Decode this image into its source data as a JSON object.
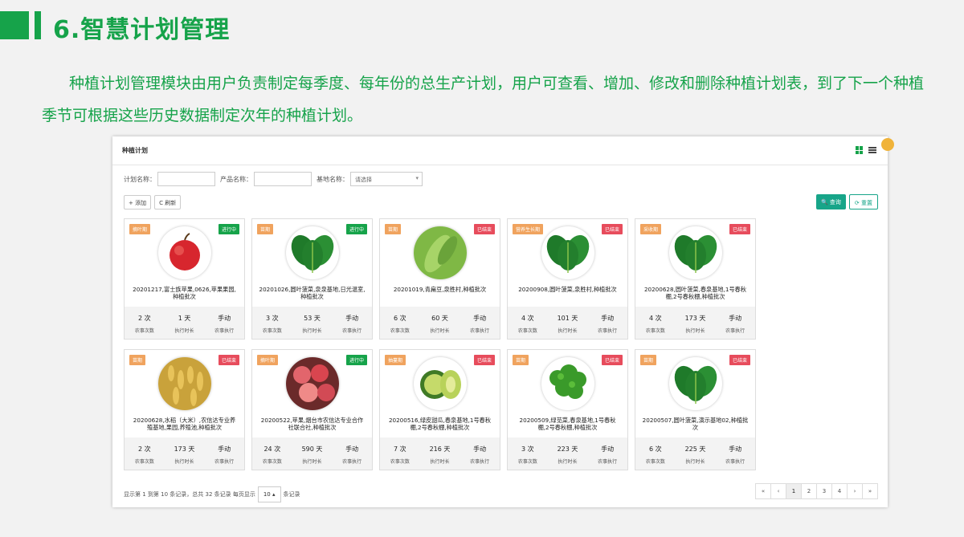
{
  "slide": {
    "title": "6.智慧计划管理",
    "description": "种植计划管理模块由用户负责制定每季度、每年份的总生产计划，用户可查看、增加、修改和删除种植计划表，到了下一个种植季节可根据这些历史数据制定次年的种植计划。"
  },
  "panel": {
    "title": "种植计划",
    "filters": {
      "plan_name_label": "计划名称：",
      "product_name_label": "产品名称：",
      "base_name_label": "基地名称：",
      "base_select_value": "请选择"
    },
    "toolbar": {
      "add": "+ 添加",
      "refresh": "C 刷新"
    },
    "buttons": {
      "search": "查询",
      "reset": "重置"
    },
    "stat_labels": {
      "farm": "农事次数",
      "duration": "执行时长",
      "exec": "农事执行"
    },
    "cards": [
      {
        "stage": "摘叶期",
        "status": "进行中",
        "status_type": "running",
        "photo": "apple",
        "title": "20201217,富士族苹果,0626,苹果果园,种植批次",
        "farm_count": "2 次",
        "duration": "1 天",
        "exec": "手动"
      },
      {
        "stage": "苗期",
        "status": "进行中",
        "status_type": "running",
        "photo": "spinach",
        "title": "20201026,圆叶菠菜,泉泉基地,日光温室,种植批次",
        "farm_count": "3 次",
        "duration": "53 天",
        "exec": "手动"
      },
      {
        "stage": "苗期",
        "status": "已结束",
        "status_type": "ended",
        "photo": "beans",
        "title": "20201019,青扁豆,泉胜村,种植批次",
        "farm_count": "6 次",
        "duration": "60 天",
        "exec": "手动"
      },
      {
        "stage": "营养生长期",
        "status": "已结束",
        "status_type": "ended",
        "photo": "spinach",
        "title": "20200908,圆叶菠菜,泉胜村,种植批次",
        "farm_count": "4 次",
        "duration": "101 天",
        "exec": "手动"
      },
      {
        "stage": "采收期",
        "status": "已结束",
        "status_type": "ended",
        "photo": "spinach",
        "title": "20200628,圆叶菠菜,春泉基地,1号春秋棚,2号春秋棚,种植批次",
        "farm_count": "4 次",
        "duration": "173 天",
        "exec": "手动"
      },
      {
        "stage": "苗期",
        "status": "已结束",
        "status_type": "ended",
        "photo": "rice",
        "title": "20200628,水稻（大米）,农信达专业养殖基地,果园,养殖池,种植批次",
        "farm_count": "2 次",
        "duration": "173 天",
        "exec": "手动"
      },
      {
        "stage": "摘叶期",
        "status": "进行中",
        "status_type": "running",
        "photo": "apples",
        "title": "20200522,苹果,烟台市农信达专业合作社联合社,种植批次",
        "farm_count": "24 次",
        "duration": "590 天",
        "exec": "手动"
      },
      {
        "stage": "抽蔓期",
        "status": "已结束",
        "status_type": "ended",
        "photo": "melon",
        "title": "20200516,绿皮甜瓜,春泉基地,1号春秋棚,2号春秋棚,种植批次",
        "farm_count": "7 次",
        "duration": "216 天",
        "exec": "手动"
      },
      {
        "stage": "苗期",
        "status": "已结束",
        "status_type": "ended",
        "photo": "greens",
        "title": "20200509,绿苋菜,春泉基地,1号春秋棚,2号春秋棚,种植批次",
        "farm_count": "3 次",
        "duration": "223 天",
        "exec": "手动"
      },
      {
        "stage": "苗期",
        "status": "已结束",
        "status_type": "ended",
        "photo": "spinach",
        "title": "20200507,圆叶菠菜,演示基地02,种植批次",
        "farm_count": "6 次",
        "duration": "225 天",
        "exec": "手动"
      }
    ],
    "pagination": {
      "info_prefix": "显示第 1 到第 10 条记录，总共 32 条记录 每页显示",
      "page_size": "10 ▴",
      "info_suffix": "条记录",
      "buttons": [
        "«",
        "‹",
        "1",
        "2",
        "3",
        "4",
        "›",
        "»"
      ],
      "active_page": "1"
    }
  }
}
